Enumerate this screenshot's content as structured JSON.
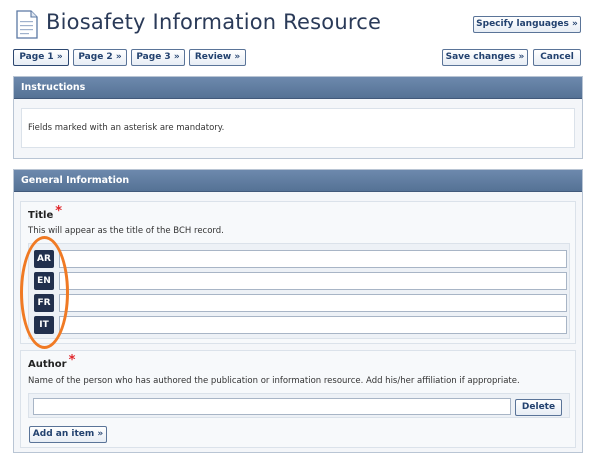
{
  "header": {
    "title": "Biosafety Information Resource",
    "specify_languages": "Specify languages »"
  },
  "nav": {
    "tabs": [
      {
        "label": "Page 1 »"
      },
      {
        "label": "Page 2 »"
      },
      {
        "label": "Page 3 »"
      },
      {
        "label": "Review »"
      }
    ],
    "save_label": "Save changes »",
    "cancel_label": "Cancel"
  },
  "instructions": {
    "heading": "Instructions",
    "text": "Fields marked with an asterisk are mandatory."
  },
  "general": {
    "heading": "General Information",
    "title_field": {
      "label": "Title",
      "required_mark": "*",
      "help": "This will appear as the title of the BCH record.",
      "languages": [
        "AR",
        "EN",
        "FR",
        "IT"
      ],
      "values": [
        "",
        "",
        "",
        ""
      ]
    },
    "author_field": {
      "label": "Author",
      "required_mark": "*",
      "help": "Name of the person who has authored the publication or information resource. Add his/her affiliation if appropriate.",
      "value": "",
      "delete_label": "Delete",
      "add_label": "Add an item »"
    }
  },
  "colors": {
    "header_bar": "#5f7ca1",
    "accent_ring": "#f07a24",
    "badge": "#22304d",
    "required": "#e0262b"
  },
  "icons": {
    "document": "document-icon"
  }
}
